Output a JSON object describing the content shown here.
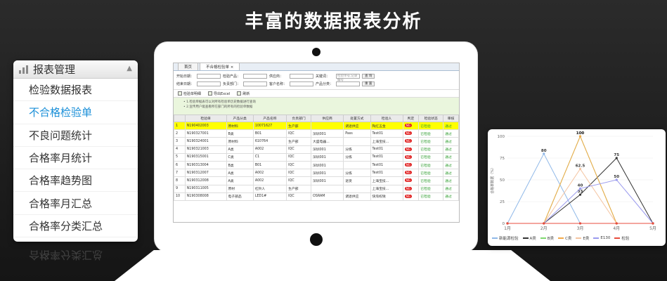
{
  "headline": "丰富的数据报表分析",
  "menu": {
    "title": "报表管理",
    "items": [
      "检验数据报表",
      "不合格检验单",
      "不良问题统计",
      "合格率月统计",
      "合格率趋势图",
      "合格率月汇总",
      "合格率分类汇总"
    ],
    "active_index": 1,
    "reflection": "合格率分类汇总"
  },
  "screen": {
    "tabs": [
      "首页",
      "不合格检验单 ×"
    ],
    "filters": {
      "row1": [
        {
          "label": "开始日期：",
          "value": ""
        },
        {
          "label": "检验产品：",
          "value": ""
        },
        {
          "label": "供应商：",
          "value": ""
        },
        {
          "label": "关键词：",
          "value": "检验单号,记录编号"
        }
      ],
      "row2": [
        {
          "label": "结束日期：",
          "value": ""
        },
        {
          "label": "负责部门：",
          "value": ""
        },
        {
          "label": "客户名称：",
          "value": ""
        },
        {
          "label": "产品分类：",
          "value": ""
        }
      ],
      "query_label": "查 询",
      "reset_label": "重 置"
    },
    "toolbar": [
      "检验单明细",
      "导出Excel",
      "刷新"
    ],
    "notes": [
      "• 1.检验单据表可以对所有检验单历史数据进行查询",
      "• 2.宣传用户能查看所在部门的所有的检验单数据"
    ],
    "columns": [
      "",
      "检验单",
      "产品分类",
      "产品名称",
      "负责部门",
      "供应商",
      "处置方式",
      "检验人",
      "判定",
      "检验状态",
      "审核"
    ],
    "rows": [
      [
        "1",
        "N190402003",
        "原材料",
        "10071627",
        "生产部",
        "",
        "调退供应",
        "陶红五金",
        "NG",
        "已检验",
        "通过"
      ],
      [
        "2",
        "N190327001",
        "B类",
        "B01",
        "IQC",
        "深圳001",
        "Pass",
        "Test01",
        "NG",
        "已检验",
        "通过"
      ],
      [
        "3",
        "N190324001",
        "原材料",
        "610764",
        "生产部",
        "大盛电器...",
        "",
        "上海宝技...",
        "NG",
        "已检验",
        "通过"
      ],
      [
        "4",
        "N190321003",
        "A类",
        "A002",
        "IQC",
        "深圳001",
        "分拣",
        "Test01",
        "NG",
        "已检验",
        "通过"
      ],
      [
        "5",
        "N190315001",
        "C类",
        "C1",
        "IQC",
        "深圳001",
        "分拣",
        "Test01",
        "NG",
        "已检验",
        "通过"
      ],
      [
        "6",
        "N190313004",
        "B类",
        "B01",
        "IQC",
        "深圳001",
        "",
        "Test01",
        "NG",
        "已检验",
        "通过"
      ],
      [
        "7",
        "N190312007",
        "A类",
        "A002",
        "IQC",
        "深圳001",
        "分拣",
        "Test01",
        "NG",
        "已检验",
        "通过"
      ],
      [
        "8",
        "N190312008",
        "A类",
        "A002",
        "IQC",
        "深圳001",
        "退货",
        "上海宝技...",
        "NG",
        "已检验",
        "通过"
      ],
      [
        "9",
        "N190311005",
        "原材",
        "杠铃人",
        "生产部",
        "",
        "",
        "上海宝技...",
        "NG",
        "已检验",
        "通过"
      ],
      [
        "10",
        "N190308008",
        "电子部品",
        "LED1#",
        "IQC",
        "OSRAM",
        "调退供应",
        "快淘权锐",
        "NG",
        "已检验",
        "通过"
      ]
    ],
    "highlight_row": 0
  },
  "chart_data": {
    "type": "line",
    "categories": [
      "1月",
      "2月",
      "3月",
      "4月",
      "5月"
    ],
    "ylim": [
      0,
      100
    ],
    "yticks": [
      0,
      25,
      50,
      75,
      100
    ],
    "ylabel": "合格率数据（%）",
    "series": [
      {
        "name": "新能源检验",
        "color": "#8fb8e8",
        "values": [
          0,
          80,
          0,
          0,
          0
        ]
      },
      {
        "name": "A类",
        "color": "#333333",
        "values": [
          0,
          0,
          33,
          75,
          0
        ]
      },
      {
        "name": "B类",
        "color": "#7fd86f",
        "values": [
          0,
          0,
          100,
          0,
          0
        ]
      },
      {
        "name": "C类",
        "color": "#f2a94a",
        "values": [
          0,
          0,
          100,
          0,
          0
        ]
      },
      {
        "name": "E类",
        "color": "#f4c4a0",
        "values": [
          0,
          0,
          62.5,
          0,
          0
        ]
      },
      {
        "name": "E130",
        "color": "#9a9aee",
        "values": [
          0,
          0,
          40,
          50,
          0
        ]
      },
      {
        "name": "检验",
        "color": "#e84c3d",
        "values": [
          0,
          0,
          0,
          0,
          0
        ]
      }
    ],
    "labels_shown": [
      "0",
      "80",
      "100",
      "100",
      "62.5",
      "50",
      "40",
      "33",
      "33.33",
      "75",
      "50"
    ]
  }
}
